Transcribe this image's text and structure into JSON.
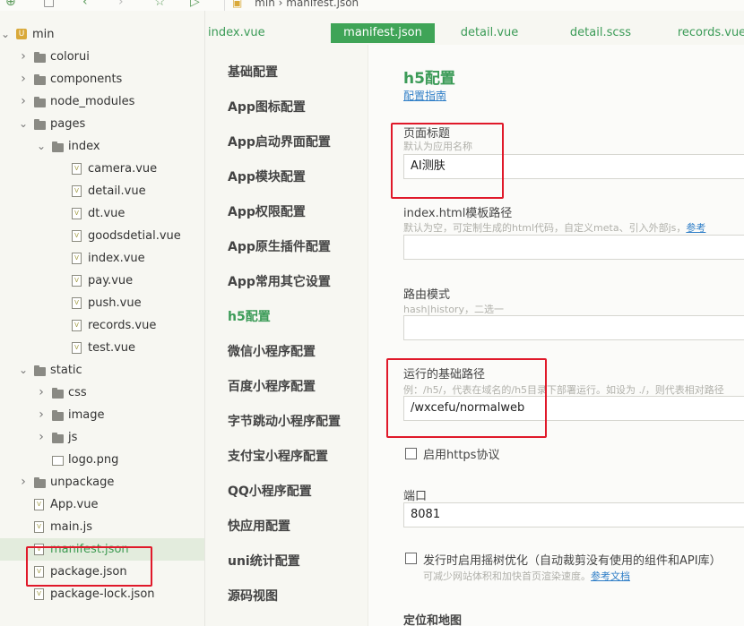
{
  "breadcrumb": {
    "project": "min",
    "file": "manifest.json"
  },
  "tree": [
    {
      "label": "min",
      "kind": "project",
      "depth": 0,
      "arrow": "open"
    },
    {
      "label": "colorui",
      "kind": "folder",
      "depth": 1,
      "arrow": "closed"
    },
    {
      "label": "components",
      "kind": "folder",
      "depth": 1,
      "arrow": "closed"
    },
    {
      "label": "node_modules",
      "kind": "folder",
      "depth": 1,
      "arrow": "closed"
    },
    {
      "label": "pages",
      "kind": "folder",
      "depth": 1,
      "arrow": "open"
    },
    {
      "label": "index",
      "kind": "folder",
      "depth": 2,
      "arrow": "open"
    },
    {
      "label": "camera.vue",
      "kind": "file",
      "depth": 3
    },
    {
      "label": "detail.vue",
      "kind": "file",
      "depth": 3
    },
    {
      "label": "dt.vue",
      "kind": "file",
      "depth": 3
    },
    {
      "label": "goodsdetial.vue",
      "kind": "file",
      "depth": 3
    },
    {
      "label": "index.vue",
      "kind": "file",
      "depth": 3
    },
    {
      "label": "pay.vue",
      "kind": "file",
      "depth": 3
    },
    {
      "label": "push.vue",
      "kind": "file",
      "depth": 3
    },
    {
      "label": "records.vue",
      "kind": "file",
      "depth": 3
    },
    {
      "label": "test.vue",
      "kind": "file",
      "depth": 3
    },
    {
      "label": "static",
      "kind": "folder",
      "depth": 1,
      "arrow": "open"
    },
    {
      "label": "css",
      "kind": "folder",
      "depth": 2,
      "arrow": "closed"
    },
    {
      "label": "image",
      "kind": "folder",
      "depth": 2,
      "arrow": "closed"
    },
    {
      "label": "js",
      "kind": "folder",
      "depth": 2,
      "arrow": "closed"
    },
    {
      "label": "logo.png",
      "kind": "image",
      "depth": 2
    },
    {
      "label": "unpackage",
      "kind": "folder",
      "depth": 1,
      "arrow": "closed"
    },
    {
      "label": "App.vue",
      "kind": "file",
      "depth": 1
    },
    {
      "label": "main.js",
      "kind": "file",
      "depth": 1
    },
    {
      "label": "manifest.json",
      "kind": "file",
      "depth": 1,
      "selected": true
    },
    {
      "label": "package.json",
      "kind": "file",
      "depth": 1
    },
    {
      "label": "package-lock.json",
      "kind": "file",
      "depth": 1
    }
  ],
  "tabs": [
    {
      "label": "index.vue",
      "active": false
    },
    {
      "label": "manifest.json",
      "active": true
    },
    {
      "label": "detail.vue",
      "active": false
    },
    {
      "label": "detail.scss",
      "active": false
    },
    {
      "label": "records.vue",
      "active": false
    }
  ],
  "settings_nav": [
    {
      "label": "基础配置",
      "active": false
    },
    {
      "label": "App图标配置",
      "active": false
    },
    {
      "label": "App启动界面配置",
      "active": false
    },
    {
      "label": "App模块配置",
      "active": false
    },
    {
      "label": "App权限配置",
      "active": false
    },
    {
      "label": "App原生插件配置",
      "active": false
    },
    {
      "label": "App常用其它设置",
      "active": false
    },
    {
      "label": "h5配置",
      "active": true
    },
    {
      "label": "微信小程序配置",
      "active": false
    },
    {
      "label": "百度小程序配置",
      "active": false
    },
    {
      "label": "字节跳动小程序配置",
      "active": false
    },
    {
      "label": "支付宝小程序配置",
      "active": false
    },
    {
      "label": "QQ小程序配置",
      "active": false
    },
    {
      "label": "快应用配置",
      "active": false
    },
    {
      "label": "uni统计配置",
      "active": false
    },
    {
      "label": "源码视图",
      "active": false
    }
  ],
  "content": {
    "title": "h5配置",
    "guide_link": "配置指南",
    "page_title": {
      "label": "页面标题",
      "hint": "默认为应用名称",
      "value": "AI测肤"
    },
    "template": {
      "label": "index.html模板路径",
      "hint": "默认为空，可定制生成的html代码，自定义meta、引入外部js，",
      "hint_link": "参考",
      "value": ""
    },
    "router": {
      "label": "路由模式",
      "hint": "hash|history，二选一",
      "value": ""
    },
    "base_path": {
      "label": "运行的基础路径",
      "hint": "例：/h5/，代表在域名的/h5目录下部署运行。如设为 ./，则代表相对路径",
      "value": "/wxcefu/normalweb"
    },
    "https": {
      "label": "启用https协议",
      "checked": false
    },
    "port": {
      "label": "端口",
      "value": "8081"
    },
    "treeshake": {
      "label": "发行时启用摇树优化（自动裁剪没有使用的组件和API库）",
      "hint": "可减少网站体积和加快首页渲染速度。",
      "hint_link": "参考文档",
      "checked": false
    },
    "next_section": "定位和地图"
  },
  "colors": {
    "accent": "#3b9b57",
    "highlight": "#e0192a",
    "link": "#2f7ec7"
  }
}
